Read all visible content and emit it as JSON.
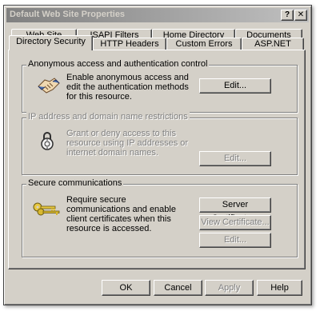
{
  "window": {
    "title": "Default Web Site Properties",
    "help_button": "?",
    "close_button": "✕"
  },
  "tabs": {
    "back_row": [
      "Web Site",
      "ISAPI Filters",
      "Home Directory",
      "Documents"
    ],
    "front_row": [
      "Directory Security",
      "HTTP Headers",
      "Custom Errors",
      "ASP.NET"
    ],
    "selected": "Directory Security"
  },
  "anonymous": {
    "title": "Anonymous access and authentication control",
    "description": "Enable anonymous access and edit the authentication methods for this resource.",
    "edit_button": "Edit..."
  },
  "ip_restrictions": {
    "title": "IP address and domain name restrictions",
    "description": "Grant or deny access to this resource using IP addresses or internet domain names.",
    "edit_button": "Edit..."
  },
  "secure": {
    "title": "Secure communications",
    "description": "Require secure communications and enable client certificates when this resource is accessed.",
    "server_certificate_button": "Server Certificate...",
    "view_certificate_button": "View Certificate...",
    "edit_button": "Edit..."
  },
  "footer": {
    "ok": "OK",
    "cancel": "Cancel",
    "apply": "Apply",
    "help": "Help"
  }
}
